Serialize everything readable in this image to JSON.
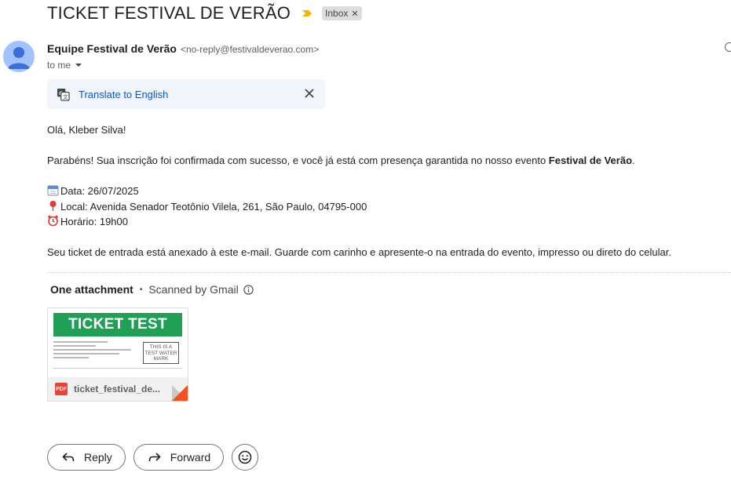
{
  "email": {
    "subject": "TICKET FESTIVAL DE VERÃO",
    "label": "Inbox",
    "sender_name": "Equipe Festival de Verão",
    "sender_email": "<no-reply@festivaldeverao.com>",
    "recipient": "to me"
  },
  "translate": {
    "link_text": "Translate to English"
  },
  "body": {
    "greeting": "Olá, Kleber Silva!",
    "confirmation_prefix": "Parabéns! Sua inscrição foi confirmada com sucesso, e você já está com presença garantida no nosso evento ",
    "event_name": "Festival de Verão",
    "confirmation_suffix": ".",
    "date_line": "Data: 26/07/2025",
    "location_line": "Local: Avenida Senador Teotônio Vilela, 261, São Paulo, 04795-000",
    "time_line": "Horário: 19h00",
    "closing": "Seu ticket de entrada está anexado à este e-mail. Guarde com carinho e apresente-o na entrada do evento, impresso ou direto do celular."
  },
  "attachments": {
    "count_label": "One attachment",
    "scan_label": "Scanned by Gmail",
    "file": {
      "thumb_title": "TICKET TEST",
      "watermark": "THIS IS A TEST WATER MARK",
      "type_badge": "PDF",
      "name": "ticket_festival_de..."
    }
  },
  "actions": {
    "reply": "Reply",
    "forward": "Forward"
  },
  "icons": {
    "importance": "importance-marker-icon",
    "avatar": "person-icon",
    "translate": "translate-icon",
    "close": "close-icon",
    "calendar": "calendar-emoji-icon",
    "pin": "pin-emoji-icon",
    "clock": "alarm-clock-emoji-icon",
    "info": "info-icon",
    "reply": "reply-arrow-icon",
    "forward": "forward-arrow-icon",
    "emoji": "smiley-icon"
  },
  "colors": {
    "importance": "#f4b400",
    "link": "#0b57d0",
    "banner": "#1fa055",
    "pdf": "#ea4335"
  }
}
